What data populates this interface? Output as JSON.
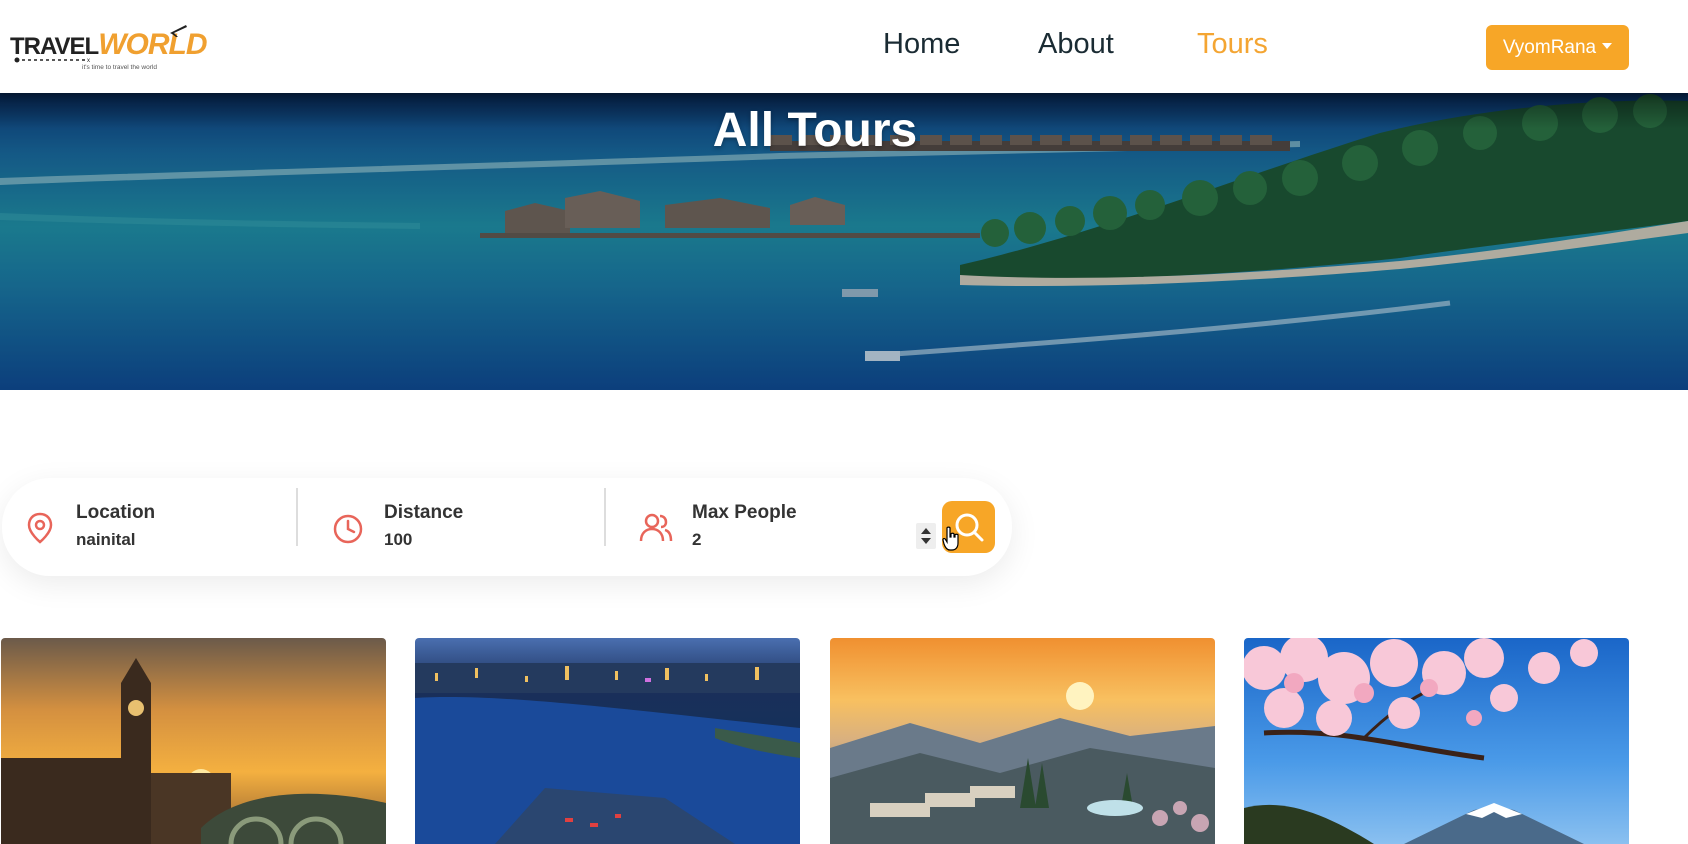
{
  "brand": {
    "name_part1": "TRAVEL",
    "name_part2": "WORLD",
    "tagline": "it's time to travel the world",
    "accent": "#f7a627"
  },
  "nav": {
    "items": [
      {
        "label": "Home",
        "active": false
      },
      {
        "label": "About",
        "active": false
      },
      {
        "label": "Tours",
        "active": true
      }
    ]
  },
  "user_menu": {
    "label": "VyomRana",
    "icon": "caret-down-icon"
  },
  "hero": {
    "title": "All Tours"
  },
  "search": {
    "location": {
      "label": "Location",
      "value": "nainital",
      "icon": "map-pin-icon"
    },
    "distance": {
      "label": "Distance",
      "value": "100",
      "icon": "clock-icon"
    },
    "max_people": {
      "label": "Max People",
      "value": "2",
      "icon": "users-icon"
    },
    "button_icon": "search-icon"
  },
  "tours": [
    {
      "image": "big-ben-sunset"
    },
    {
      "image": "city-lake-night"
    },
    {
      "image": "mountain-sunrise-resort"
    },
    {
      "image": "cherry-blossom-mount-fuji"
    }
  ]
}
